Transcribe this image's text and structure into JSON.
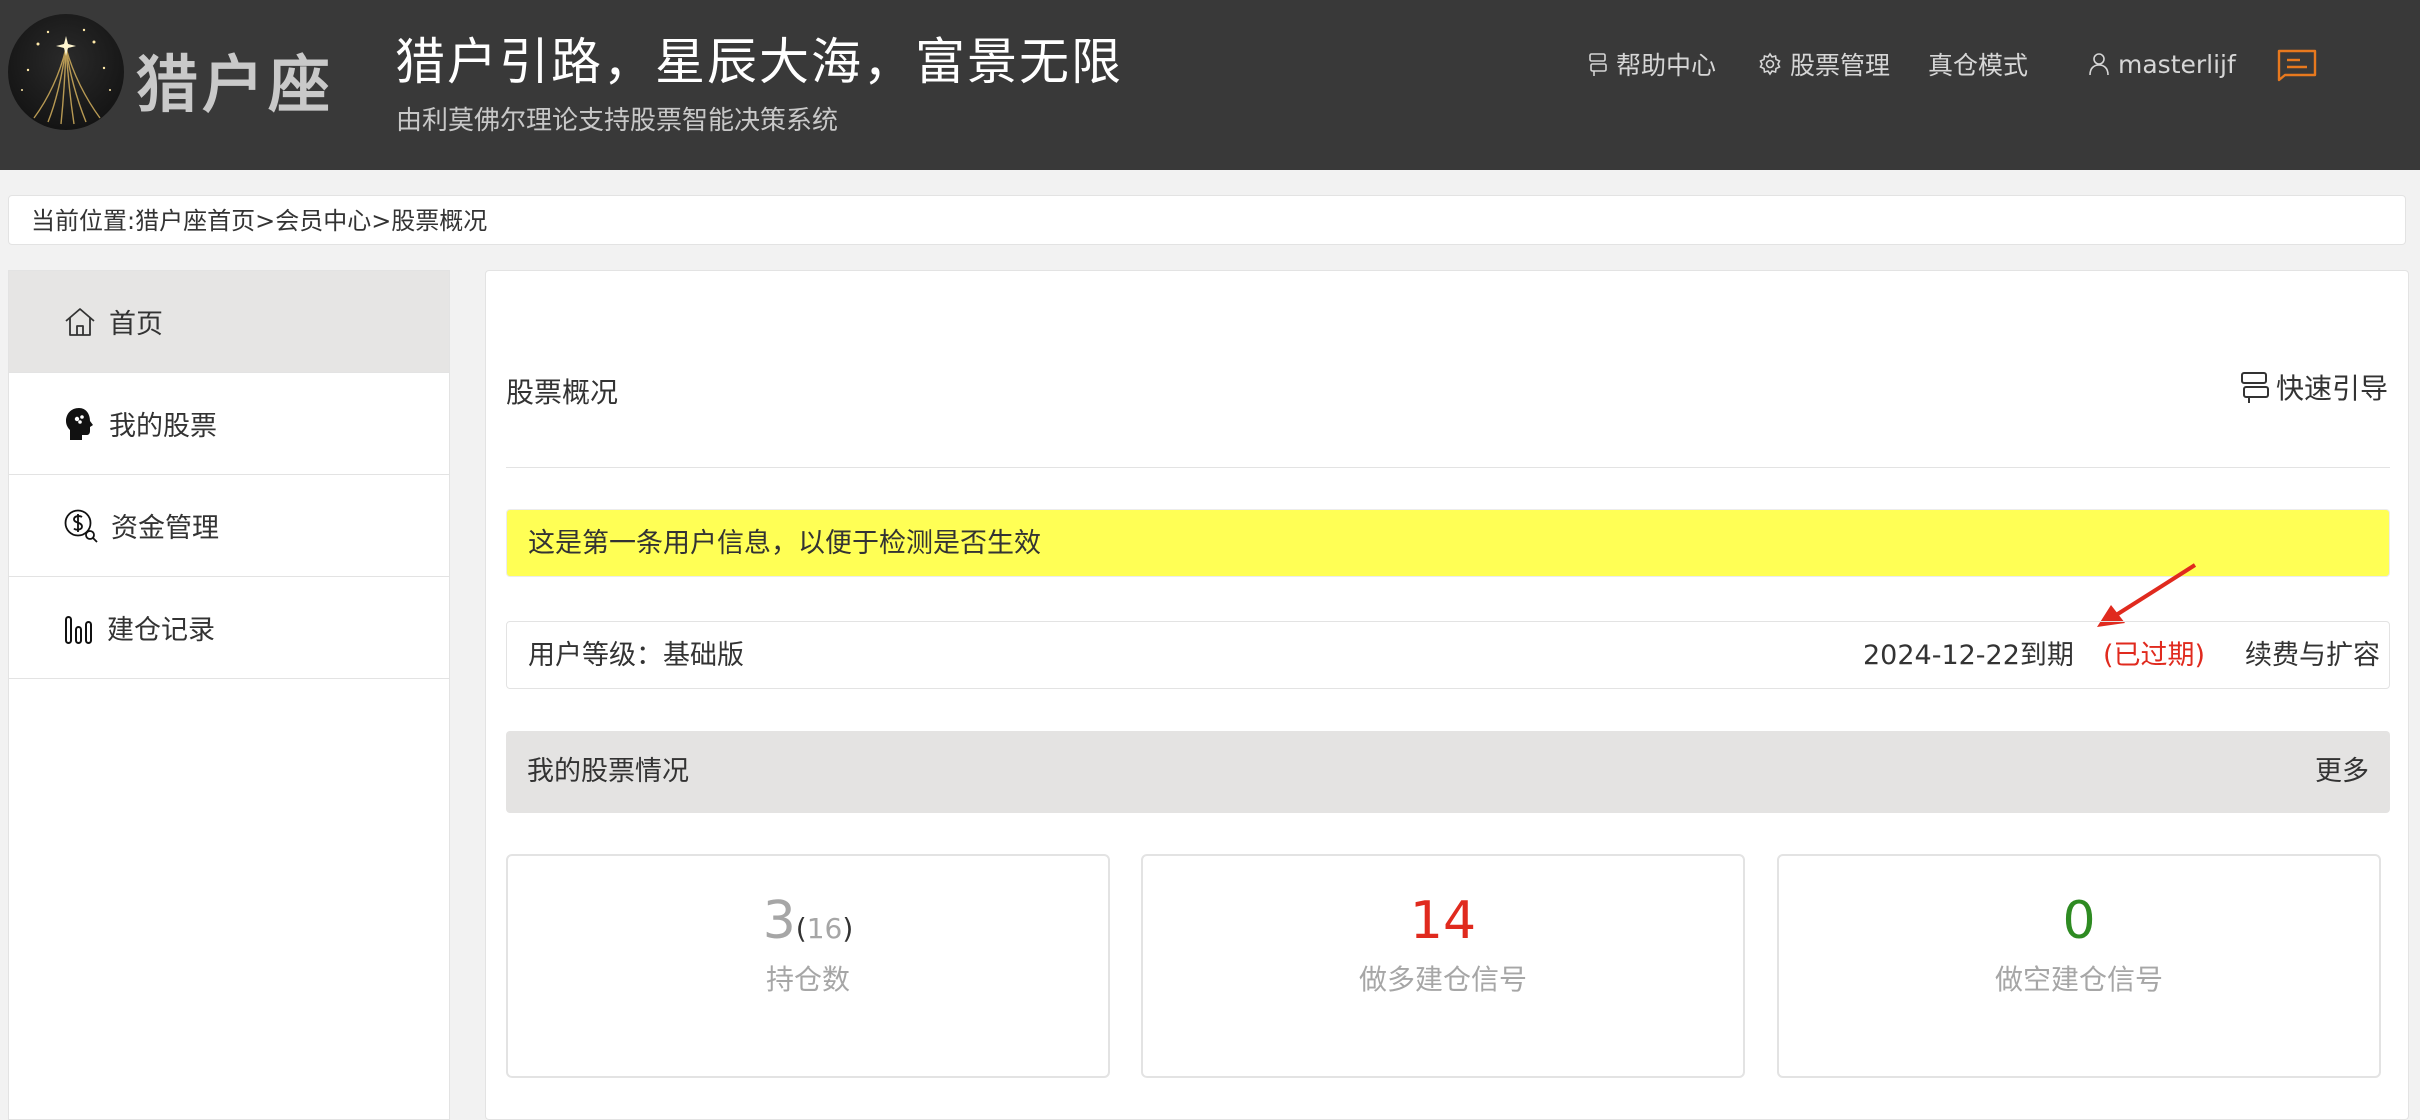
{
  "header": {
    "logo_text": "猎户座",
    "slogan": "猎户引路，星辰大海，富景无限",
    "subslogan": "由利莫佛尔理论支持股票智能决策系统",
    "nav": {
      "help": "帮助中心",
      "stocks": "股票管理",
      "real_mode": "真仓模式",
      "username": "masterlijf"
    }
  },
  "breadcrumb": "当前位置:猎户座首页>会员中心>股票概况",
  "sidebar": {
    "items": [
      {
        "label": "首页",
        "icon": "home-icon",
        "active": true
      },
      {
        "label": "我的股票",
        "icon": "head-brain-icon"
      },
      {
        "label": "资金管理",
        "icon": "money-search-icon"
      },
      {
        "label": "建仓记录",
        "icon": "bar-chart-icon"
      }
    ]
  },
  "main": {
    "title": "股票概况",
    "quick_guide": "快速引导",
    "notice": "这是第一条用户信息，以便于检测是否生效",
    "level": {
      "label": "用户等级：基础版",
      "expire": "2024-12-22到期",
      "status": "(已过期)",
      "renew": "续费与扩容"
    },
    "stock_section": {
      "title": "我的股票情况",
      "more": "更多"
    },
    "cards": [
      {
        "value": "3",
        "sub_value": "16",
        "label": "持仓数",
        "color": "#a6a6a6"
      },
      {
        "value": "14",
        "label": "做多建仓信号",
        "color": "#e02a1e"
      },
      {
        "value": "0",
        "label": "做空建仓信号",
        "color": "#2e8b22"
      }
    ]
  },
  "colors": {
    "header_bg": "#393939",
    "notice_bg": "#ffff55",
    "expired": "#e02a1e",
    "accent_orange": "#e8791e"
  }
}
